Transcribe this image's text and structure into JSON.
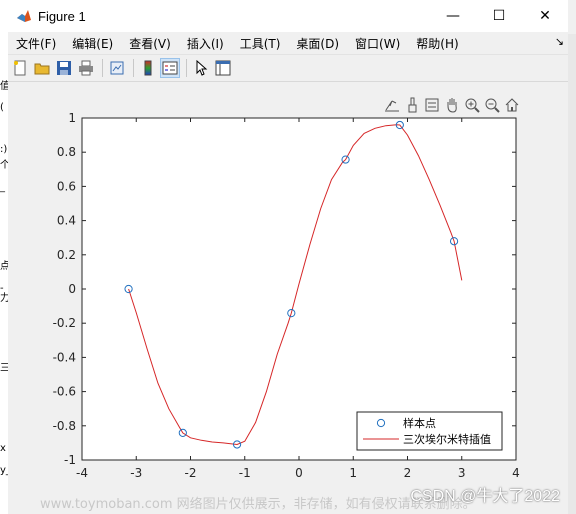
{
  "window": {
    "title": "Figure 1"
  },
  "window_controls": {
    "minimize": "—",
    "maximize": "☐",
    "close": "✕"
  },
  "menus": [
    "文件(F)",
    "编辑(E)",
    "查看(V)",
    "插入(I)",
    "工具(T)",
    "桌面(D)",
    "窗口(W)",
    "帮助(H)"
  ],
  "menubar_arrow": "↘",
  "toolbar_icons": [
    "new-figure-icon",
    "open-file-icon",
    "save-icon",
    "print-icon",
    "link-plot-icon",
    "insert-colorbar-icon",
    "insert-legend-icon",
    "edit-plot-icon",
    "property-editor-icon"
  ],
  "axes_toolbar_icons": [
    "export-icon",
    "brush-icon",
    "data-tips-icon",
    "pan-icon",
    "zoom-in-icon",
    "zoom-out-icon",
    "home-icon"
  ],
  "editor_chars": [
    "值",
    "(",
    ":)",
    "个",
    "_",
    "点",
    "-力",
    "三",
    "x",
    "y_"
  ],
  "colors": {
    "sample_marker": "#1f6fbf",
    "interp_line": "#d62728"
  },
  "chart_data": {
    "type": "line",
    "xlim": [
      -4,
      4
    ],
    "ylim": [
      -1,
      1
    ],
    "xticks": [
      "-4",
      "-3",
      "-2",
      "-1",
      "0",
      "1",
      "2",
      "3",
      "4"
    ],
    "yticks": [
      "-1",
      "-0.8",
      "-0.6",
      "-0.4",
      "-0.2",
      "0",
      "0.2",
      "0.4",
      "0.6",
      "0.8",
      "1"
    ],
    "legend_position": "bottom-right",
    "series": [
      {
        "name": "样本点",
        "style": "markers",
        "x": [
          -3.1416,
          -2.1416,
          -1.1416,
          -0.1416,
          0.8584,
          1.8584,
          2.8584
        ],
        "y": [
          0.0,
          -0.8415,
          -0.9093,
          -0.1411,
          0.7568,
          0.9589,
          0.2794
        ]
      },
      {
        "name": "三次埃尔米特插值",
        "style": "line",
        "x": [
          -3.1416,
          -3.0,
          -2.8,
          -2.6,
          -2.4,
          -2.2,
          -2.1416,
          -2.0,
          -1.8,
          -1.6,
          -1.4,
          -1.2,
          -1.1416,
          -1.0,
          -0.8,
          -0.6,
          -0.4,
          -0.2,
          -0.1416,
          0.0,
          0.2,
          0.4,
          0.6,
          0.8,
          0.8584,
          1.0,
          1.2,
          1.4,
          1.6,
          1.8,
          1.8584,
          2.0,
          2.2,
          2.4,
          2.6,
          2.8,
          2.8584,
          3.0
        ],
        "y": [
          0.0,
          -0.14,
          -0.35,
          -0.55,
          -0.7,
          -0.81,
          -0.8415,
          -0.87,
          -0.885,
          -0.895,
          -0.9,
          -0.907,
          -0.9093,
          -0.89,
          -0.78,
          -0.6,
          -0.38,
          -0.2,
          -0.1411,
          0.03,
          0.26,
          0.47,
          0.64,
          0.74,
          0.7568,
          0.84,
          0.91,
          0.94,
          0.955,
          0.96,
          0.9589,
          0.9,
          0.78,
          0.64,
          0.49,
          0.33,
          0.2794,
          0.05
        ]
      }
    ]
  },
  "watermark": "www.toymoban.com 网络图片仅供展示，非存储，如有侵权请联系删除。",
  "csdn": "CSDN @牛大了2022"
}
